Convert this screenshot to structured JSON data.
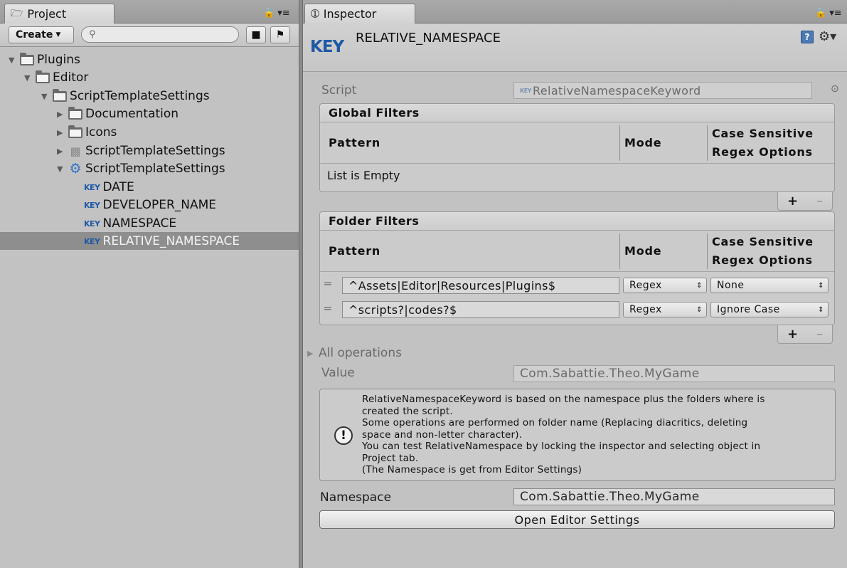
{
  "project": {
    "tab_title": "Project",
    "create_label": "Create",
    "search_placeholder": "",
    "tree": [
      {
        "label": "Plugins",
        "kind": "folder"
      },
      {
        "label": "Editor",
        "kind": "folder"
      },
      {
        "label": "ScriptTemplateSettings",
        "kind": "folder"
      },
      {
        "label": "Documentation",
        "kind": "folder"
      },
      {
        "label": "Icons",
        "kind": "folder"
      },
      {
        "label": "ScriptTemplateSettings",
        "kind": "script"
      },
      {
        "label": "ScriptTemplateSettings",
        "kind": "settings-asset"
      },
      {
        "label": "DATE",
        "kind": "keyword",
        "tag": "KEY"
      },
      {
        "label": "DEVELOPER_NAME",
        "kind": "keyword",
        "tag": "KEY"
      },
      {
        "label": "NAMESPACE",
        "kind": "keyword",
        "tag": "KEY"
      },
      {
        "label": "RELATIVE_NAMESPACE",
        "kind": "keyword",
        "tag": "KEY",
        "selected": true
      }
    ]
  },
  "inspector": {
    "tab_title": "Inspector",
    "key_tag": "KEY",
    "title": "RELATIVE_NAMESPACE",
    "script_label": "Script",
    "script_tag": "KEY",
    "script_value": "RelativeNamespaceKeyword",
    "global_filters": {
      "title": "Global Filters",
      "col_pattern": "Pattern",
      "col_mode": "Mode",
      "col_case": "Case Sensitive",
      "col_regex": "Regex Options",
      "empty_text": "List is Empty",
      "add": "+",
      "remove": "–"
    },
    "folder_filters": {
      "title": "Folder Filters",
      "col_pattern": "Pattern",
      "col_mode": "Mode",
      "col_case": "Case Sensitive",
      "col_regex": "Regex Options",
      "rows": [
        {
          "pattern": "^Assets|Editor|Resources|Plugins$",
          "mode": "Regex",
          "option": "None"
        },
        {
          "pattern": "^scripts?|codes?$",
          "mode": "Regex",
          "option": "Ignore Case"
        }
      ],
      "add": "+",
      "remove": "–"
    },
    "all_operations": "All operations",
    "value_label": "Value",
    "value": "Com.Sabattie.Theo.MyGame",
    "help_lines": [
      "RelativeNamespaceKeyword is based on the namespace plus the folders where is",
      "created the script.",
      "Some operations are performed on folder name (Replacing diacritics, deleting",
      "space and non-letter character).",
      "You can test RelativeNamespace by locking the inspector and selecting object in",
      "Project tab.",
      "(The Namespace is get from Editor Settings)"
    ],
    "namespace_label": "Namespace",
    "namespace_value": "Com.Sabattie.Theo.MyGame",
    "open_settings_label": "Open Editor Settings"
  },
  "colors": {
    "key_blue": "#1f59a6",
    "selection": "#8e8e8e",
    "panel_bg": "#c2c2c2"
  }
}
